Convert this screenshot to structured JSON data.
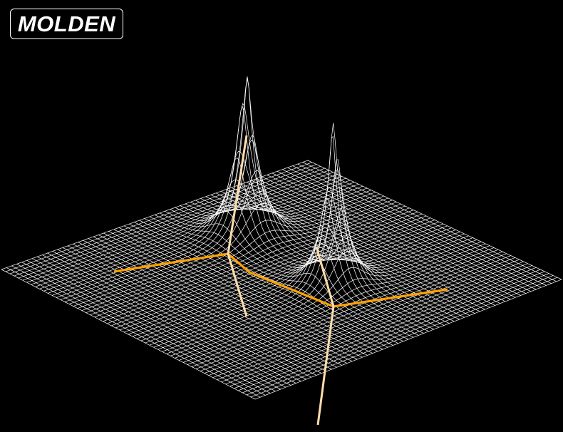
{
  "app": {
    "logo_text": "MOLDEN"
  },
  "colors": {
    "background": "#000000",
    "mesh": "#ffffff",
    "mesh_peak_tint": "#ffe0b0",
    "bond": "#ffa200",
    "axis_line": "#ffdcaa"
  },
  "scene": {
    "description_type": "3d-wireframe-density-surface",
    "peaks": 2
  }
}
